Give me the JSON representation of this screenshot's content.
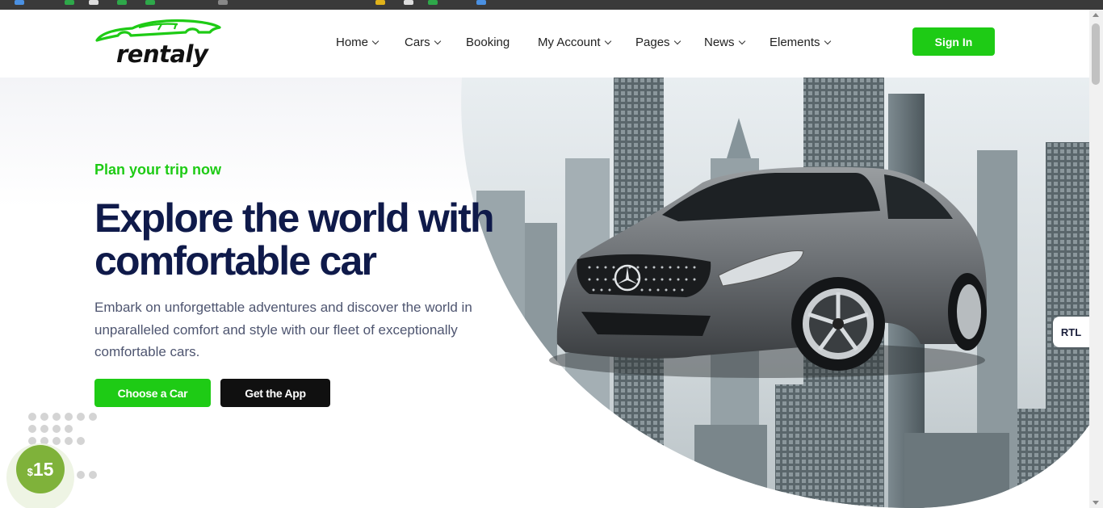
{
  "brand": {
    "name": "rentaly",
    "accent": "#1ecb15",
    "text_dark": "#0f1a4a"
  },
  "nav": {
    "items": [
      {
        "label": "Home",
        "dropdown": true
      },
      {
        "label": "Cars",
        "dropdown": true
      },
      {
        "label": "Booking",
        "dropdown": false
      },
      {
        "label": "My Account",
        "dropdown": true
      },
      {
        "label": "Pages",
        "dropdown": true
      },
      {
        "label": "News",
        "dropdown": true
      },
      {
        "label": "Elements",
        "dropdown": true
      }
    ],
    "sign_in": "Sign In"
  },
  "hero": {
    "eyebrow": "Plan your trip now",
    "headline": "Explore the world with comfortable car",
    "description": "Embark on unforgettable adventures and discover the world in unparalleled comfort and style with our fleet of exceptionally comfortable cars.",
    "primary_button": "Choose a Car",
    "secondary_button": "Get the App"
  },
  "price_badge": {
    "currency": "$",
    "amount": "15"
  },
  "rtl_toggle": "RTL",
  "icons": {
    "chevron": "chevron-down-icon",
    "logo": "car-logo-icon"
  }
}
